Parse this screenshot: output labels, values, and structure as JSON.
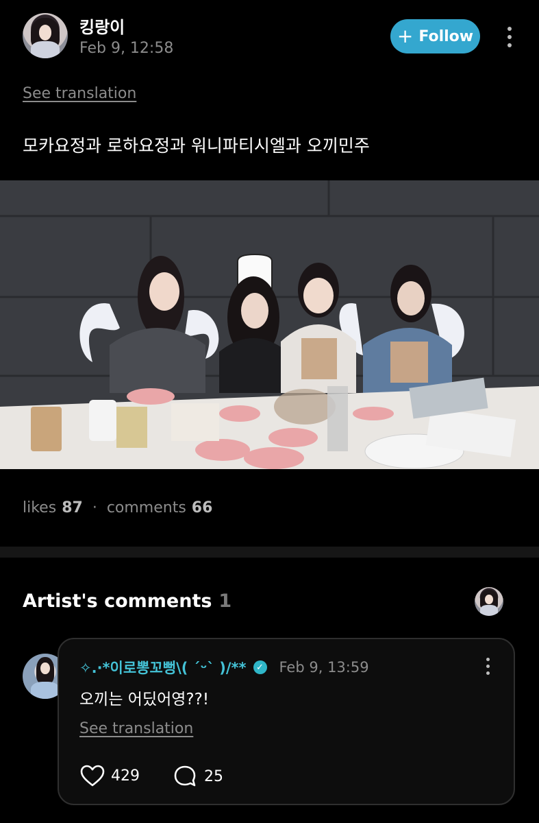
{
  "post": {
    "author_name": "킹랑이",
    "timestamp": "Feb 9, 12:58",
    "follow_label": "Follow",
    "see_translation": "See translation",
    "body_text": "모카요정과 로하요정과 워니파티시엘과 오끼민주"
  },
  "stats": {
    "likes_label": "likes",
    "likes_count": "87",
    "separator": "·",
    "comments_label": "comments",
    "comments_count": "66"
  },
  "artist_section": {
    "title": "Artist's comments",
    "count": "1"
  },
  "comment": {
    "author_name": "✧.·*이로뽕꼬뻥\\( ˊᵕˋ )/**",
    "timestamp": "Feb 9, 13:59",
    "text": "오끼는 어딨어영??!",
    "see_translation": "See translation",
    "likes": "429",
    "replies": "25"
  },
  "icons": {
    "follow": "plus-icon",
    "more": "kebab-icon",
    "verified": "verified-badge-icon",
    "like": "heart-icon",
    "reply": "speech-bubble-icon"
  },
  "colors": {
    "background": "#000000",
    "accent": "#34a7cf",
    "verified": "#2fb6c8",
    "muted_text": "#8c8c8c",
    "card_border": "#2f2f2f"
  }
}
